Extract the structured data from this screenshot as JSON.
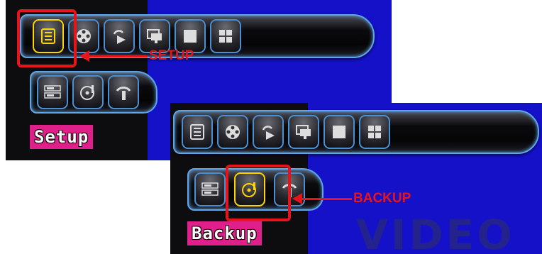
{
  "colors": {
    "highlight": "#e8141c",
    "panel_blue": "#1411c9",
    "panel_dark": "#0d0d10",
    "selected_icon": "#ffd500",
    "label_bg": "#e0208a",
    "toolbar_border": "#5fa6e8"
  },
  "setup_panel": {
    "main_icons": [
      "list-icon",
      "film-reel-icon",
      "playback-icon",
      "monitor-icon",
      "single-view-icon",
      "quad-view-icon"
    ],
    "sub_icons": [
      "vcr-icon",
      "disc-backup-icon",
      "network-icon"
    ],
    "selected_main": "list-icon",
    "label": "Setup",
    "callout": "SETUP"
  },
  "backup_panel": {
    "main_icons": [
      "list-icon",
      "film-reel-icon",
      "playback-icon",
      "monitor-icon",
      "single-view-icon",
      "quad-view-icon"
    ],
    "sub_icons": [
      "vcr-icon",
      "disc-backup-icon",
      "network-icon"
    ],
    "selected_sub": "disc-backup-icon",
    "label": "Backup",
    "callout": "BACKUP",
    "watermark": "VIDEO"
  }
}
